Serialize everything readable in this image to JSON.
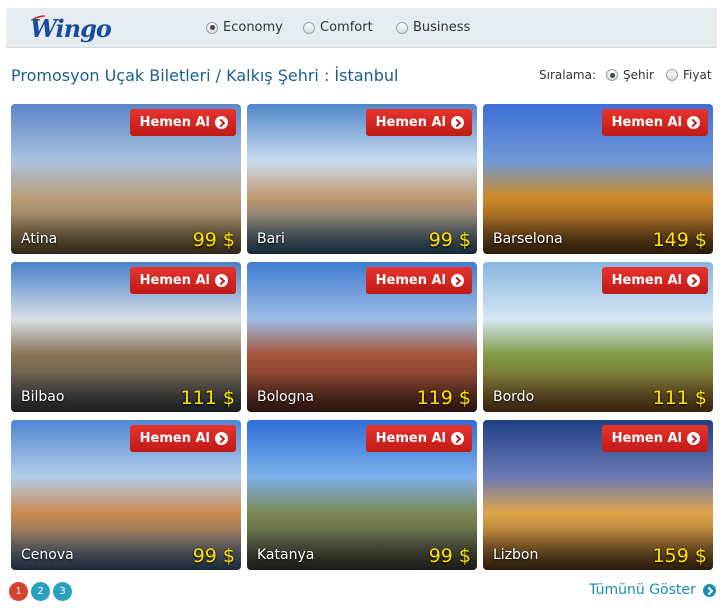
{
  "header": {
    "logo": "Wingo",
    "classes": [
      {
        "label": "Economy",
        "selected": true
      },
      {
        "label": "Comfort",
        "selected": false
      },
      {
        "label": "Business",
        "selected": false
      }
    ]
  },
  "title": "Promosyon Uçak Biletleri / Kalkış Şehri :  İstanbul",
  "sort": {
    "label": "Sıralama:",
    "options": [
      {
        "label": "Şehir",
        "selected": true
      },
      {
        "label": "Fiyat",
        "selected": false
      }
    ]
  },
  "buy_label": "Hemen Al",
  "cards": [
    {
      "city": "Atina",
      "price": "99 $",
      "colors": [
        "#5b86c8",
        "#a9c2df",
        "#b9a07a",
        "#6b5638"
      ]
    },
    {
      "city": "Bari",
      "price": "99 $",
      "colors": [
        "#4f86c9",
        "#c9dcef",
        "#c29a72",
        "#2e5a78"
      ]
    },
    {
      "city": "Barselona",
      "price": "149 $",
      "colors": [
        "#3d6ed6",
        "#6f9ad8",
        "#cf8a2a",
        "#5a3a16"
      ]
    },
    {
      "city": "Bilbao",
      "price": "111 $",
      "colors": [
        "#4a80c8",
        "#d8dfe6",
        "#8a7357",
        "#37424a"
      ]
    },
    {
      "city": "Bologna",
      "price": "119 $",
      "colors": [
        "#3f7bd0",
        "#9dbde6",
        "#a5543a",
        "#5a2c20"
      ]
    },
    {
      "city": "Bordo",
      "price": "111 $",
      "colors": [
        "#86b6e0",
        "#d6e8f4",
        "#7f9a45",
        "#7a4a22"
      ]
    },
    {
      "city": "Cenova",
      "price": "99 $",
      "colors": [
        "#4d86d4",
        "#b5cde9",
        "#c98a4e",
        "#3a5f86"
      ]
    },
    {
      "city": "Katanya",
      "price": "99 $",
      "colors": [
        "#2c6fd8",
        "#7fb0ea",
        "#7c8a55",
        "#3c3a36"
      ]
    },
    {
      "city": "Lizbon",
      "price": "159 $",
      "colors": [
        "#1f3f86",
        "#6a78b4",
        "#e0a64a",
        "#5a3c1a"
      ]
    }
  ],
  "pagination": [
    "1",
    "2",
    "3"
  ],
  "active_page": "1",
  "show_all": "Tümünü Göster"
}
